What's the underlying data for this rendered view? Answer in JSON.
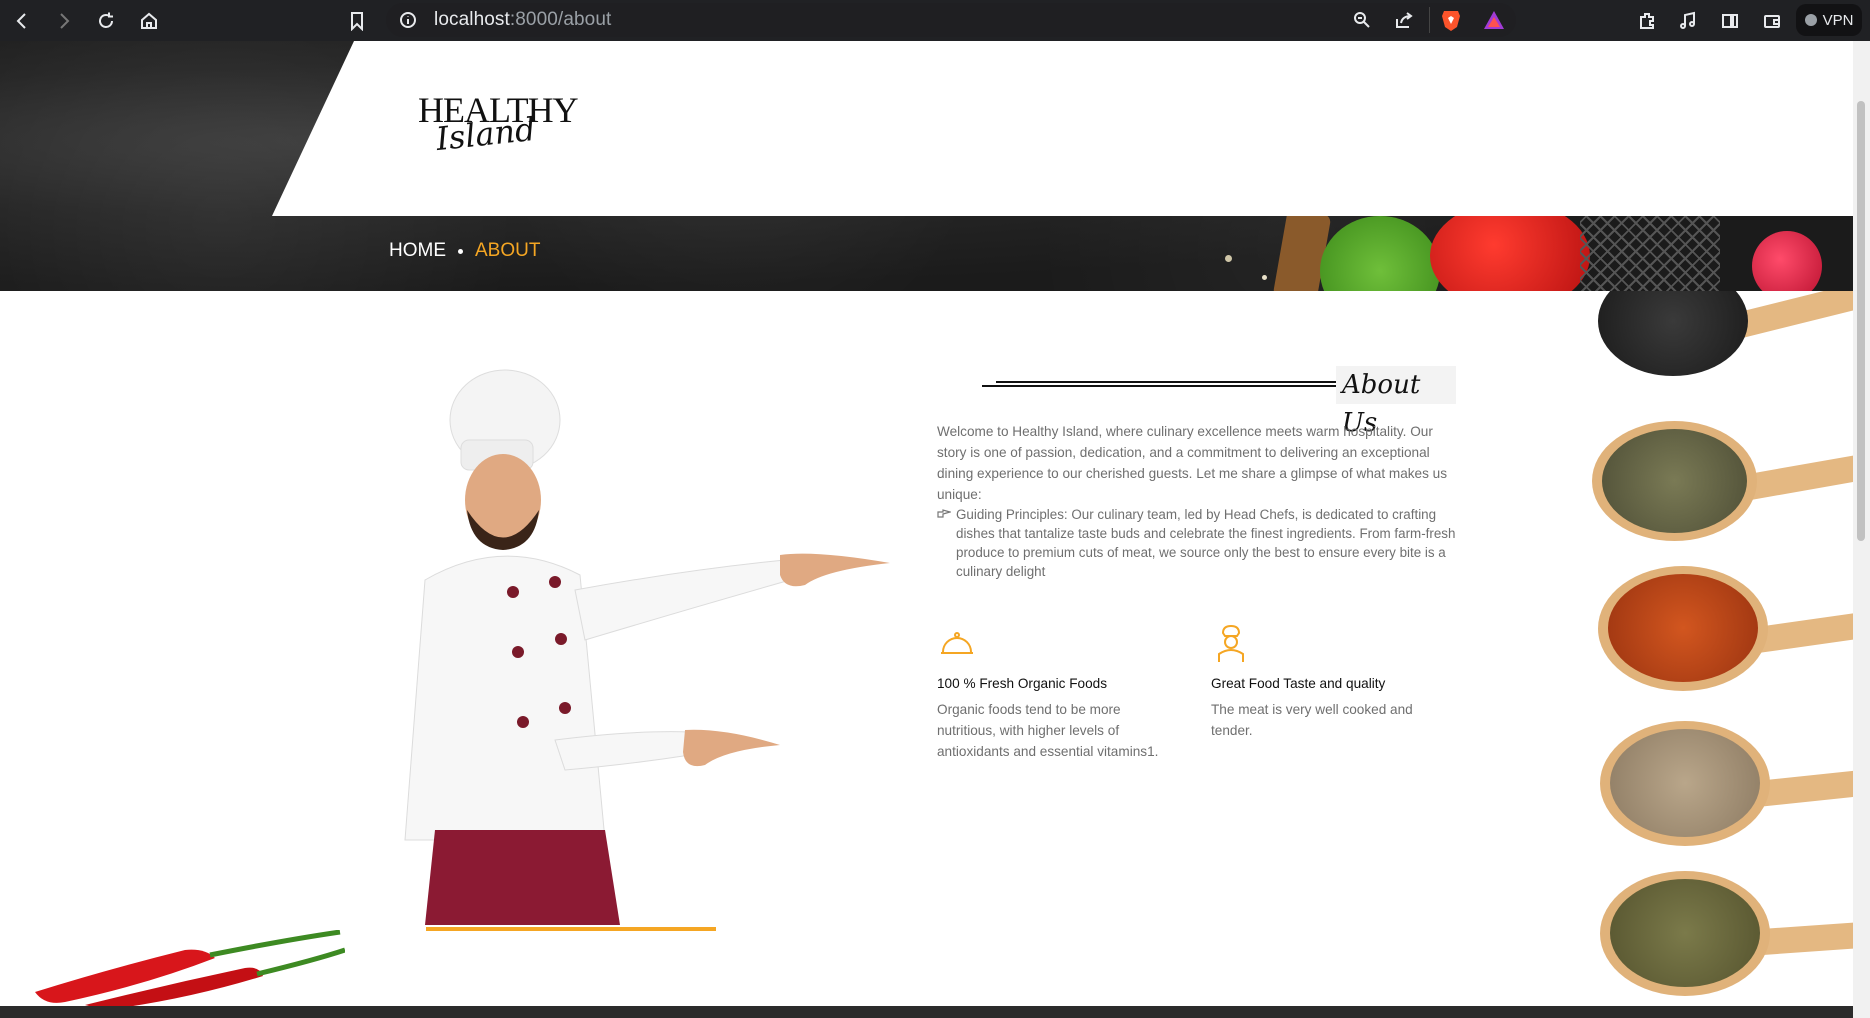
{
  "browser": {
    "url_host": "localhost",
    "url_path": ":8000/about",
    "vpn_label": "VPN"
  },
  "header": {
    "logo_word": "HEALTHY",
    "logo_script": "Island"
  },
  "hero": {
    "title_fragment": "About Us",
    "breadcrumb": [
      {
        "label": "HOME"
      },
      {
        "label": "ABOUT"
      }
    ]
  },
  "about": {
    "heading": "About Us",
    "intro": "Welcome to Healthy Island, where culinary excellence meets warm hospitality. Our story is one of passion, dedication, and a commitment to delivering an exceptional dining experience to our cherished guests. Let me share a glimpse of what makes us unique:",
    "principle": "Guiding Principles: Our culinary team, led by Head Chefs, is dedicated to crafting dishes that tantalize taste buds and celebrate the finest ingredients. From farm-fresh produce to premium cuts of meat, we source only the best to ensure every bite is a culinary delight",
    "features": [
      {
        "icon": "cloche-icon",
        "title": "100 % Fresh Organic Foods",
        "description": "Organic foods tend to be more nutritious, with higher levels of antioxidants and essential vitamins1."
      },
      {
        "icon": "chef-icon",
        "title": "Great Food Taste and quality",
        "description": "The meat is very well cooked and tender."
      }
    ]
  },
  "colors": {
    "accent": "#f5a623",
    "text_muted": "#6f6f6f",
    "hero_dark": "#1c1c1c"
  }
}
